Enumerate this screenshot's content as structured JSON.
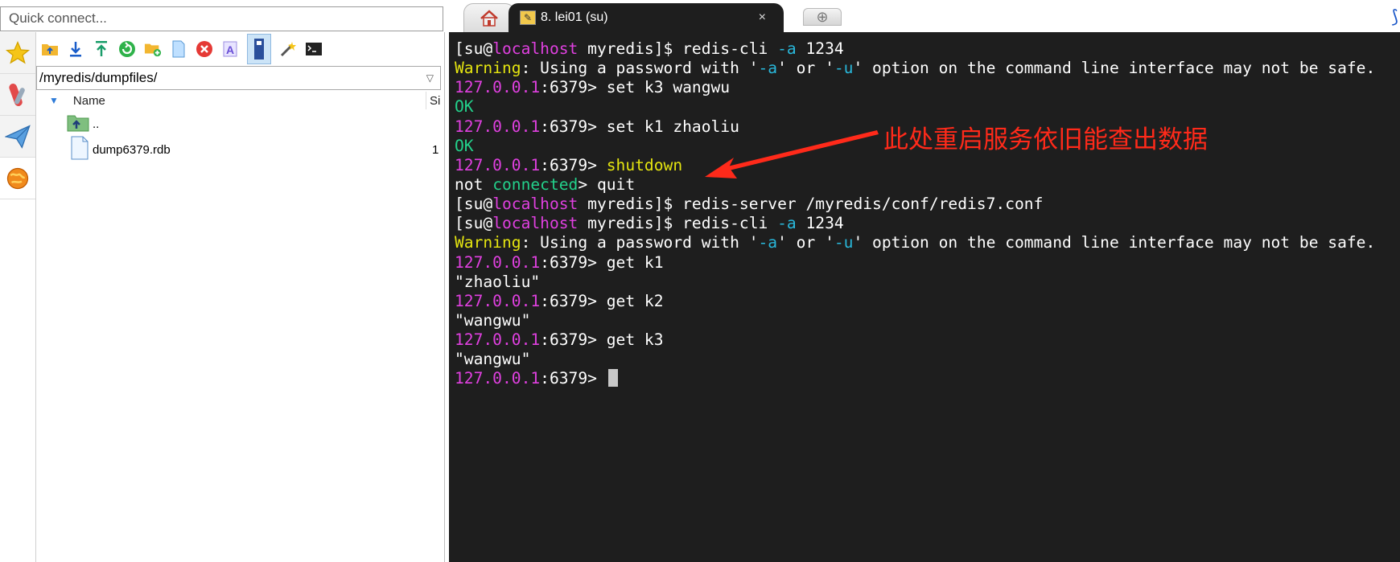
{
  "quick_connect": {
    "placeholder": "Quick connect..."
  },
  "tabs": {
    "home_icon": "home-icon",
    "active_label": "8. lei01 (su)",
    "active_close": "×",
    "new_tab_glyph": "⊕"
  },
  "sftp": {
    "path": "/myredis/dumpfiles/",
    "columns": {
      "name": "Name",
      "size": "Si"
    },
    "files": [
      {
        "name": "..",
        "size": "",
        "icon": "folder-up-icon"
      },
      {
        "name": "dump6379.rdb",
        "size": "1",
        "icon": "file-icon"
      }
    ]
  },
  "colors": {
    "terminal_bg": "#1e1e1e",
    "magenta": "#e040e0",
    "yellow": "#e5e510",
    "green": "#23d18b",
    "cyan": "#29b8db",
    "annotation": "#ff2a1a"
  },
  "terminal": {
    "lines": [
      [
        {
          "t": "[su@",
          "c": "w"
        },
        {
          "t": "localhost",
          "c": "m"
        },
        {
          "t": " myredis]$ redis-cli ",
          "c": "w"
        },
        {
          "t": "-a",
          "c": "c"
        },
        {
          "t": " 1234",
          "c": "w"
        }
      ],
      [
        {
          "t": "Warning",
          "c": "y"
        },
        {
          "t": ": Using a password with '",
          "c": "w"
        },
        {
          "t": "-a",
          "c": "c"
        },
        {
          "t": "' or '",
          "c": "w"
        },
        {
          "t": "-u",
          "c": "c"
        },
        {
          "t": "' option on the command line interface may not be safe.",
          "c": "w"
        }
      ],
      [
        {
          "t": "127.0.0.1",
          "c": "m"
        },
        {
          "t": ":6379> set k3 wangwu",
          "c": "w"
        }
      ],
      [
        {
          "t": "OK",
          "c": "g"
        }
      ],
      [
        {
          "t": "127.0.0.1",
          "c": "m"
        },
        {
          "t": ":6379> set k1 zhaoliu",
          "c": "w"
        }
      ],
      [
        {
          "t": "OK",
          "c": "g"
        }
      ],
      [
        {
          "t": "127.0.0.1",
          "c": "m"
        },
        {
          "t": ":6379> ",
          "c": "w"
        },
        {
          "t": "shutdown",
          "c": "y"
        }
      ],
      [
        {
          "t": "not ",
          "c": "w"
        },
        {
          "t": "connected",
          "c": "g"
        },
        {
          "t": "> quit",
          "c": "w"
        }
      ],
      [
        {
          "t": "[su@",
          "c": "w"
        },
        {
          "t": "localhost",
          "c": "m"
        },
        {
          "t": " myredis]$ redis-server /myredis/conf/redis7.conf",
          "c": "w"
        }
      ],
      [
        {
          "t": "[su@",
          "c": "w"
        },
        {
          "t": "localhost",
          "c": "m"
        },
        {
          "t": " myredis]$ redis-cli ",
          "c": "w"
        },
        {
          "t": "-a",
          "c": "c"
        },
        {
          "t": " 1234",
          "c": "w"
        }
      ],
      [
        {
          "t": "Warning",
          "c": "y"
        },
        {
          "t": ": Using a password with '",
          "c": "w"
        },
        {
          "t": "-a",
          "c": "c"
        },
        {
          "t": "' or '",
          "c": "w"
        },
        {
          "t": "-u",
          "c": "c"
        },
        {
          "t": "' option on the command line interface may not be safe.",
          "c": "w"
        }
      ],
      [
        {
          "t": "127.0.0.1",
          "c": "m"
        },
        {
          "t": ":6379> get k1",
          "c": "w"
        }
      ],
      [
        {
          "t": "\"zhaoliu\"",
          "c": "w"
        }
      ],
      [
        {
          "t": "127.0.0.1",
          "c": "m"
        },
        {
          "t": ":6379> get k2",
          "c": "w"
        }
      ],
      [
        {
          "t": "\"wangwu\"",
          "c": "w"
        }
      ],
      [
        {
          "t": "127.0.0.1",
          "c": "m"
        },
        {
          "t": ":6379> get k3",
          "c": "w"
        }
      ],
      [
        {
          "t": "\"wangwu\"",
          "c": "w"
        }
      ],
      [
        {
          "t": "127.0.0.1",
          "c": "m"
        },
        {
          "t": ":6379> ",
          "c": "w"
        }
      ]
    ]
  },
  "annotation": {
    "text": "此处重启服务依旧能查出数据"
  }
}
